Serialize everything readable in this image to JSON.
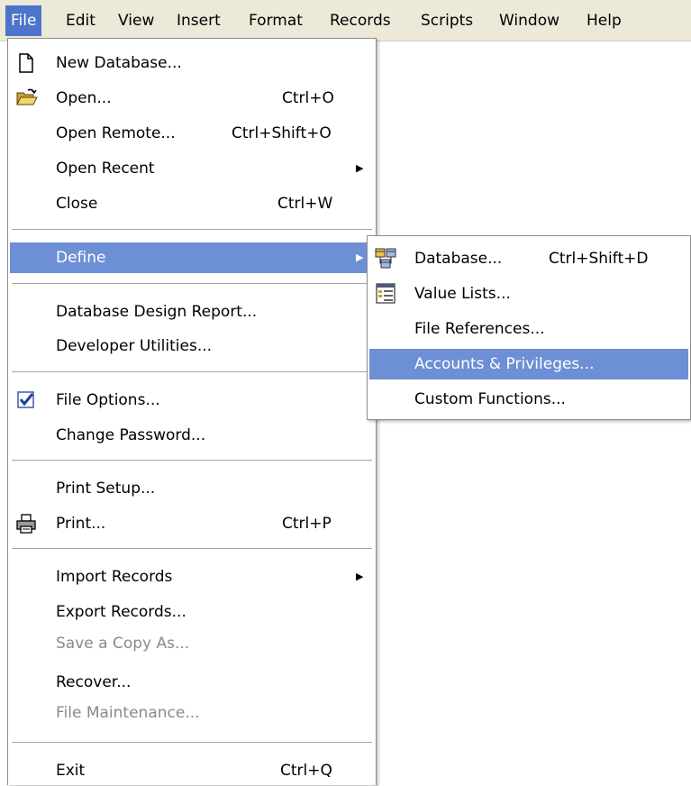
{
  "menubar": {
    "items": [
      "File",
      "Edit",
      "View",
      "Insert",
      "Format",
      "Records",
      "Scripts",
      "Window",
      "Help"
    ]
  },
  "file_menu": {
    "new_database": "New Database...",
    "open": "Open...",
    "open_shortcut": "Ctrl+O",
    "open_remote": "Open Remote...",
    "open_remote_shortcut": "Ctrl+Shift+O",
    "open_recent": "Open Recent",
    "close": "Close",
    "close_shortcut": "Ctrl+W",
    "define": "Define",
    "database_design_report": "Database Design Report...",
    "developer_utilities": "Developer Utilities...",
    "file_options": "File Options...",
    "change_password": "Change Password...",
    "print_setup": "Print Setup...",
    "print": "Print...",
    "print_shortcut": "Ctrl+P",
    "import_records": "Import Records",
    "export_records": "Export Records...",
    "save_copy_as": "Save a Copy As...",
    "recover": "Recover...",
    "file_maintenance": "File Maintenance...",
    "exit": "Exit",
    "exit_shortcut": "Ctrl+Q"
  },
  "define_menu": {
    "database": "Database...",
    "database_shortcut": "Ctrl+Shift+D",
    "value_lists": "Value Lists...",
    "file_references": "File References...",
    "accounts_privileges": "Accounts & Privileges...",
    "custom_functions": "Custom Functions..."
  },
  "icons": {
    "new_database": "document-icon",
    "open": "folder-open-icon",
    "file_options": "checkmark-icon",
    "print": "printer-icon",
    "database": "database-tables-icon",
    "value_lists": "value-list-icon"
  },
  "colors": {
    "menubar_bg": "#ece9d8",
    "active_menu": "#4c74c9",
    "highlight": "#6d8fd5",
    "disabled_text": "#8a8a8a"
  }
}
